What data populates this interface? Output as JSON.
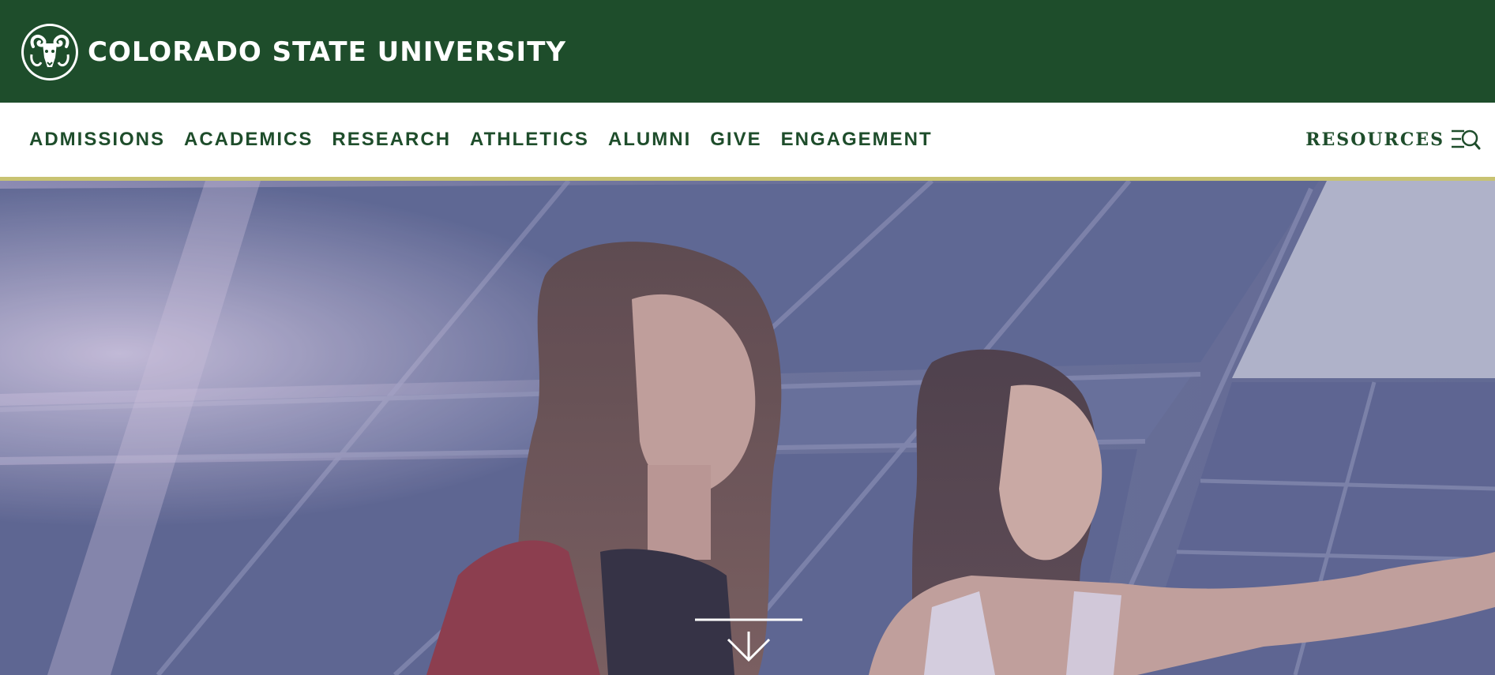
{
  "header": {
    "university_name": "COLORADO STATE UNIVERSITY",
    "logo_icon": "ram-logo-icon",
    "brand_color": "#1e4d2b",
    "accent_color": "#c8c372"
  },
  "nav": {
    "items": [
      {
        "label": "ADMISSIONS"
      },
      {
        "label": "ACADEMICS"
      },
      {
        "label": "RESEARCH"
      },
      {
        "label": "ATHLETICS"
      },
      {
        "label": "ALUMNI"
      },
      {
        "label": "GIVE"
      },
      {
        "label": "ENGAGEMENT"
      }
    ],
    "resources": {
      "label": "RESOURCES",
      "icon": "resources-search-icon"
    }
  },
  "hero": {
    "scroll_icon": "scroll-down-arrow-icon"
  }
}
